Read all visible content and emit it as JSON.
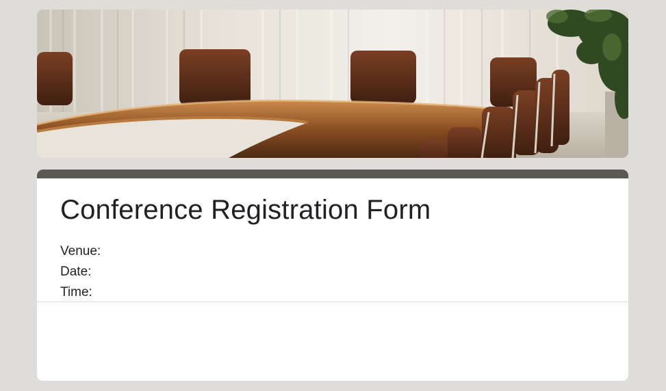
{
  "banner": {
    "alt": "Conference room with a long wooden table and brown leather chairs"
  },
  "form": {
    "title": "Conference Registration Form",
    "details": [
      {
        "label": "Venue:",
        "value": ""
      },
      {
        "label": "Date:",
        "value": ""
      },
      {
        "label": "Time:",
        "value": ""
      }
    ]
  },
  "colors": {
    "page_background": "#deddda",
    "accent_bar": "#5b5a52",
    "card_background": "#ffffff",
    "text": "#202124"
  }
}
